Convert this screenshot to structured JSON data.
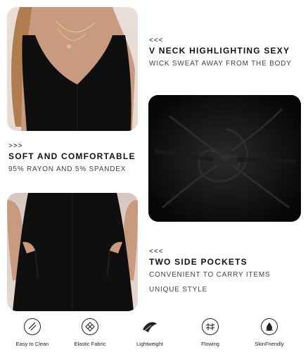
{
  "sections": [
    {
      "marker": "<<<",
      "heading": "V NECK HIGHLIGHTING SEXY",
      "sub": "WICK SWEAT AWAY FROM THE BODY"
    },
    {
      "marker": ">>>",
      "heading": "SOFT AND COMFORTABLE",
      "sub": "95% RAYON AND 5% SPANDEX"
    },
    {
      "marker": "<<<",
      "heading": "TWO SIDE POCKETS",
      "sub": "CONVENIENT TO CARRY ITEMS",
      "sub2": "UNIQUE STYLE"
    }
  ],
  "features": [
    {
      "label": "Easy to Clean",
      "icon": "wash-icon"
    },
    {
      "label": "Elastic Fabric",
      "icon": "fabric-mesh-icon"
    },
    {
      "label": "Lightweight",
      "icon": "feather-icon"
    },
    {
      "label": "Flowing",
      "icon": "wind-icon"
    },
    {
      "label": "SkinFriendly",
      "icon": "skin-drop-icon"
    }
  ],
  "colors": {
    "dress": "#0f0f0f",
    "skin": "#c99a7e",
    "hair": "#a8774a",
    "background": "#ffffff"
  }
}
